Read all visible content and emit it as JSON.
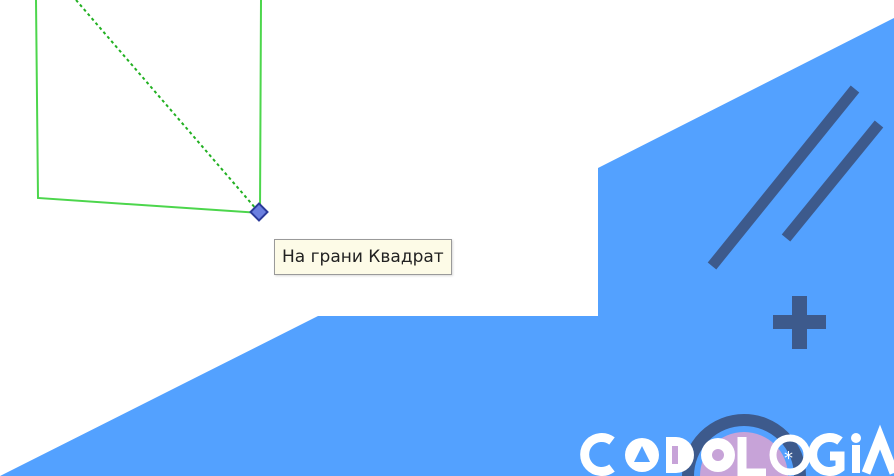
{
  "canvas": {
    "background_color": "#ffffff"
  },
  "shape": {
    "stroke_color": "#4cd64c",
    "guide_line_color": "#22b022",
    "vertex_icon": "diamond-vertex-icon",
    "vertex_fill": "#6b7fe0",
    "vertex_stroke": "#2b3a9a"
  },
  "tooltip": {
    "text": "На грани Квадрат"
  },
  "banner": {
    "background_color": "#53a1ff",
    "decor_color": "#3d5a8c",
    "decor_icons": [
      "double-slash-icon",
      "plus-icon",
      "arc-icon"
    ],
    "logo_text": "CODOLOGIA"
  }
}
